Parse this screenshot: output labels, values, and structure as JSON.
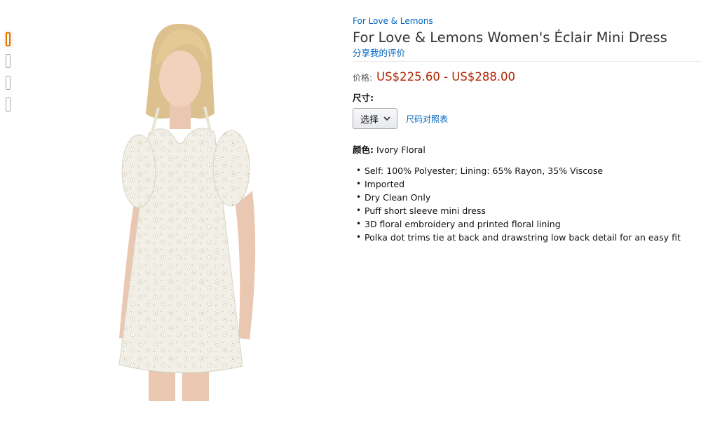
{
  "thumbnails": [
    {
      "label": "thumb-1",
      "active": true
    },
    {
      "label": "thumb-2",
      "active": false
    },
    {
      "label": "thumb-3",
      "active": false
    },
    {
      "label": "thumb-4",
      "active": false
    }
  ],
  "product": {
    "brand": "For Love & Lemons",
    "title": "For Love & Lemons Women's Éclair Mini Dress",
    "share_review": "分享我的评价",
    "price_label": "价格:",
    "price_value": "US$225.60 - US$288.00",
    "size_label": "尺寸:",
    "size_select": "选择",
    "size_chart": "尺码对照表",
    "color_label": "颜色:",
    "color_value": "Ivory Floral",
    "bullets": [
      "Self: 100% Polyester; Lining: 65% Rayon, 35% Viscose",
      "Imported",
      "Dry Clean Only",
      "Puff short sleeve mini dress",
      "3D floral embroidery and printed floral lining",
      "Polka dot trims tie at back and drawstring low back detail for an easy fit"
    ]
  },
  "colors": {
    "link": "#0066c0",
    "price": "#b12704",
    "active_thumb": "#e77600"
  },
  "icons": {
    "select_chevron": "chevron-down-icon"
  }
}
